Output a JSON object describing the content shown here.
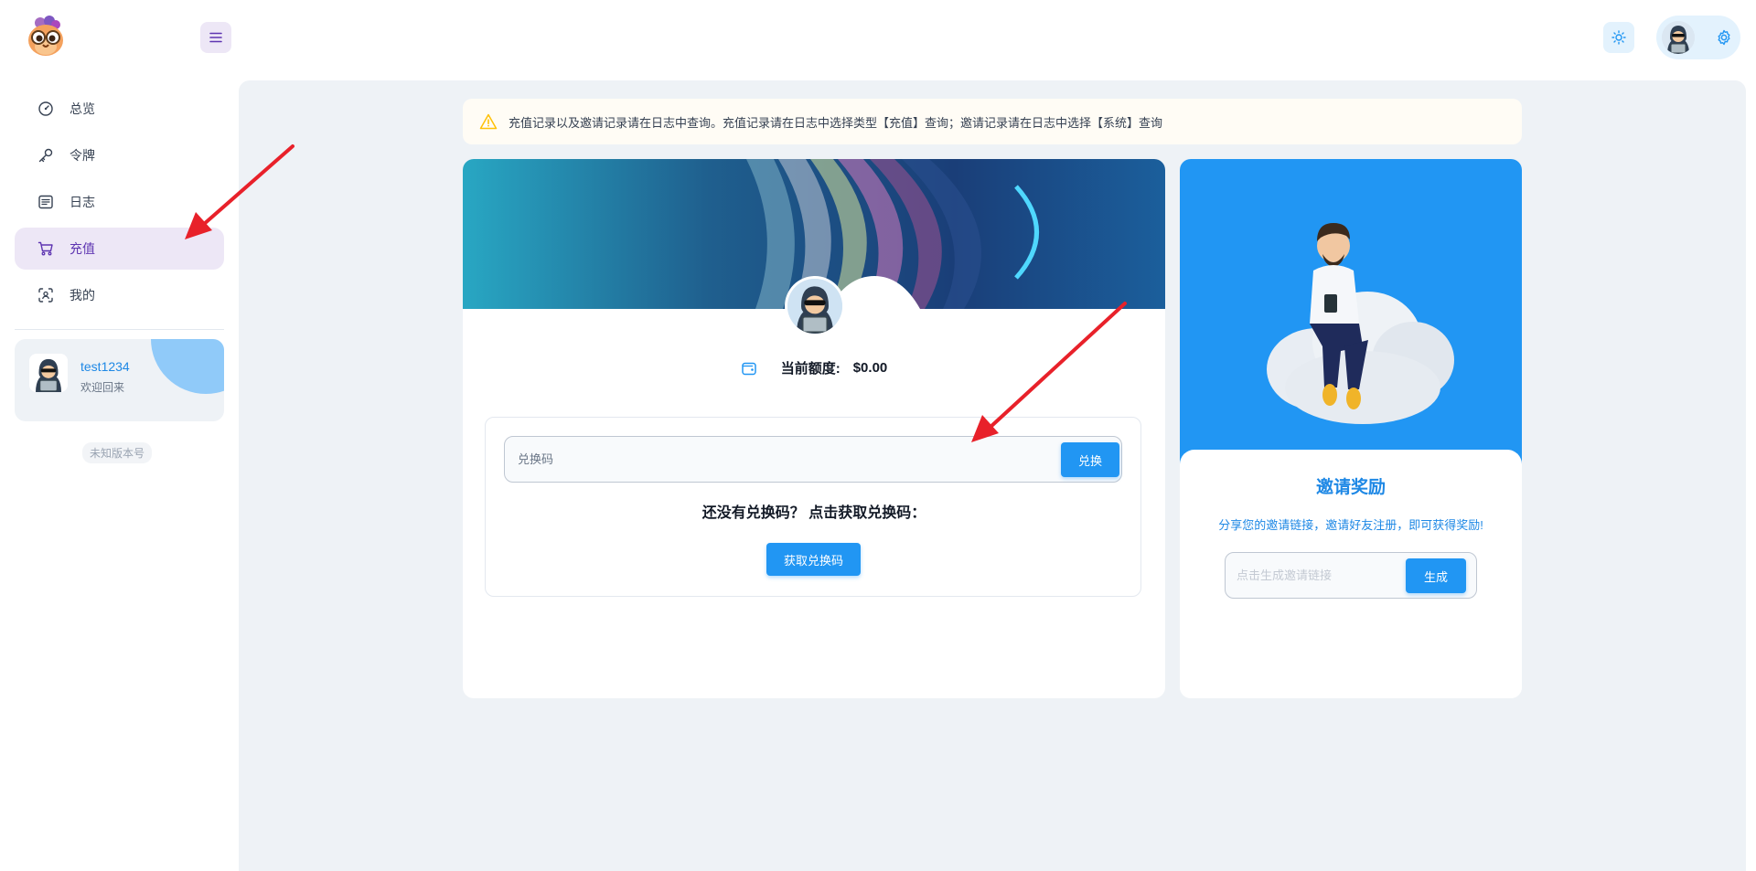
{
  "header": {
    "logo_icon": "cartoon-owl-logo",
    "menu_icon": "hamburger-menu-icon",
    "theme_icon": "sun-icon",
    "settings_icon": "gear-icon"
  },
  "sidebar": {
    "items": [
      {
        "label": "总览",
        "icon": "dashboard-gauge-icon"
      },
      {
        "label": "令牌",
        "icon": "key-icon"
      },
      {
        "label": "日志",
        "icon": "article-list-icon"
      },
      {
        "label": "充值",
        "icon": "shopping-cart-icon",
        "active": true
      },
      {
        "label": "我的",
        "icon": "user-scan-icon"
      }
    ],
    "user_card": {
      "username": "test1234",
      "welcome": "欢迎回来"
    },
    "version": "未知版本号"
  },
  "main": {
    "alert": {
      "text": "充值记录以及邀请记录请在日志中查询。充值记录请在日志中选择类型【充值】查询；邀请记录请在日志中选择【系统】查询",
      "icon": "warning-triangle-icon"
    },
    "topup": {
      "balance_label": "当前额度:",
      "balance_value": "$0.00",
      "wallet_icon": "wallet-icon",
      "redeem_placeholder": "兑换码",
      "redeem_button": "兑换",
      "hint": "还没有兑换码？ 点击获取兑换码：",
      "get_code_button": "获取兑换码"
    },
    "invite": {
      "title": "邀请奖励",
      "description": "分享您的邀请链接，邀请好友注册，即可获得奖励!",
      "link_placeholder": "点击生成邀请链接",
      "generate_button": "生成"
    }
  },
  "colors": {
    "primary": "#2196f3",
    "secondary": "#5e35b1",
    "background": "#eef2f6",
    "annotation_arrow": "#e8212a"
  }
}
